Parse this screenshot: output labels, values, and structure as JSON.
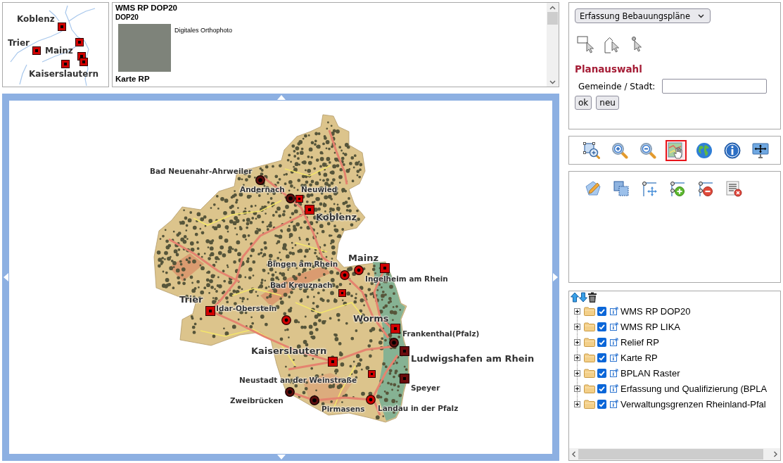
{
  "overview_map": {
    "labels": [
      "Koblenz",
      "Trier",
      "Mainz",
      "Kaiserslautern"
    ]
  },
  "legend": {
    "layers": [
      {
        "title": "WMS RP DOP20",
        "sublayers": [
          {
            "name": "DOP20",
            "description": "Digitales Orthophoto"
          }
        ]
      },
      {
        "title": "Karte RP"
      }
    ]
  },
  "map": {
    "cities": [
      {
        "label": "Bad Neuenahr-Ahrweiler",
        "kind": "dark-circle"
      },
      {
        "label": "Andernach",
        "kind": "dark-circle"
      },
      {
        "label": "Neuwied",
        "kind": "small-square"
      },
      {
        "label": "Koblenz",
        "kind": "square"
      },
      {
        "label": "Mainz",
        "kind": "square"
      },
      {
        "label": "Bingen am Rhein",
        "kind": "circle"
      },
      {
        "label": "Ingelheim am Rhein",
        "kind": "circle"
      },
      {
        "label": "Bad Kreuznach",
        "kind": "small-square"
      },
      {
        "label": "Trier",
        "kind": "square"
      },
      {
        "label": "Idar-Oberstein",
        "kind": "circle"
      },
      {
        "label": "Worms",
        "kind": "square"
      },
      {
        "label": "Frankenthal(Pfalz)",
        "kind": "dark-circle"
      },
      {
        "label": "Kaiserslautern",
        "kind": "square"
      },
      {
        "label": "Ludwigshafen am Rhein",
        "kind": "dark-square"
      },
      {
        "label": "Neustadt an der Weinstraße",
        "kind": "small-square"
      },
      {
        "label": "Speyer",
        "kind": "dark-square"
      },
      {
        "label": "Zweibrücken",
        "kind": "dark-circle"
      },
      {
        "label": "Pirmasens",
        "kind": "dark-circle"
      },
      {
        "label": "Landau in der Pfalz",
        "kind": "circle"
      }
    ]
  },
  "plan_selection": {
    "dropdown": "Erfassung Bebauungspläne",
    "selection_tools": [
      {
        "kind": "rectangle",
        "selected": false
      },
      {
        "kind": "polygon",
        "selected": false
      },
      {
        "kind": "point",
        "selected": false
      }
    ],
    "heading": "Planauswahl",
    "field": {
      "label": "Gemeinde / Stadt:"
    },
    "buttons": [
      "ok",
      "neu"
    ]
  },
  "map_tools": [
    {
      "kind": "zoom-box",
      "selected": false
    },
    {
      "kind": "zoom-in",
      "selected": false
    },
    {
      "kind": "zoom-out",
      "selected": false
    },
    {
      "kind": "pan",
      "selected": true
    },
    {
      "kind": "globe",
      "selected": false
    },
    {
      "kind": "info",
      "selected": false
    },
    {
      "kind": "full-extent",
      "selected": false
    }
  ],
  "edit_tools": [
    {
      "kind": "draw-polygon",
      "selected": false
    },
    {
      "kind": "merge",
      "selected": false
    },
    {
      "kind": "move-vertex",
      "selected": false
    },
    {
      "kind": "add-vertex",
      "selected": false
    },
    {
      "kind": "remove-vertex",
      "selected": false
    },
    {
      "kind": "clear",
      "selected": false
    }
  ],
  "layer_tree": {
    "layers": [
      {
        "label": "WMS RP DOP20",
        "expanded": false,
        "checked": true
      },
      {
        "label": "WMS RP LIKA",
        "expanded": false,
        "checked": true
      },
      {
        "label": "Relief RP",
        "expanded": false,
        "checked": true
      },
      {
        "label": "Karte RP",
        "expanded": false,
        "checked": true
      },
      {
        "label": "BPLAN Raster",
        "expanded": false,
        "checked": true
      },
      {
        "label": "Erfassung und Qualifizierung (BPLA",
        "expanded": false,
        "checked": true
      },
      {
        "label": "Verwaltungsgrenzen Rheinland-Pfal",
        "expanded": false,
        "checked": true
      }
    ]
  }
}
